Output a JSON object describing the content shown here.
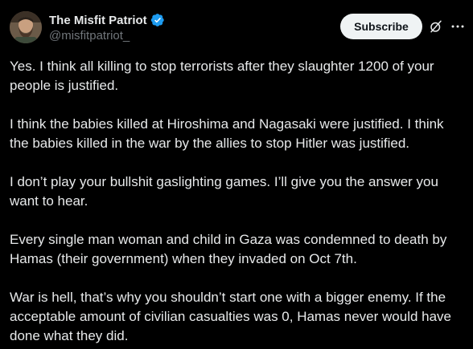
{
  "author": {
    "display_name": "The Misfit Patriot",
    "handle": "@misfitpatriot_",
    "verified": true,
    "verified_color": "#1d9bf0"
  },
  "actions": {
    "subscribe_label": "Subscribe"
  },
  "icons": {
    "avatar": "avatar-photo",
    "verified": "verified-badge-icon",
    "grok": "grok-icon",
    "more": "more-icon"
  },
  "tweet": {
    "paragraphs": [
      "Yes. I think all killing to stop terrorists after they slaughter 1200 of your people is justified.",
      "I think the babies killed at Hiroshima and Nagasaki were justified. I think the babies killed in the war by the allies to stop Hitler was justified.",
      "I don’t play your bullshit gaslighting games. I’ll give you the answer you want to hear.",
      "Every single man woman and child in Gaza was condemned to death by Hamas (their government) when they invaded on Oct 7th.",
      "War is hell, that’s why you shouldn’t start one with a bigger enemy. If the acceptable amount of civilian casualties was 0, Hamas never would have done what they did."
    ]
  },
  "colors": {
    "background": "#000000",
    "text": "#e7e9ea",
    "secondary_text": "#71767b",
    "button_bg": "#eff3f4",
    "button_text": "#0f1419"
  }
}
